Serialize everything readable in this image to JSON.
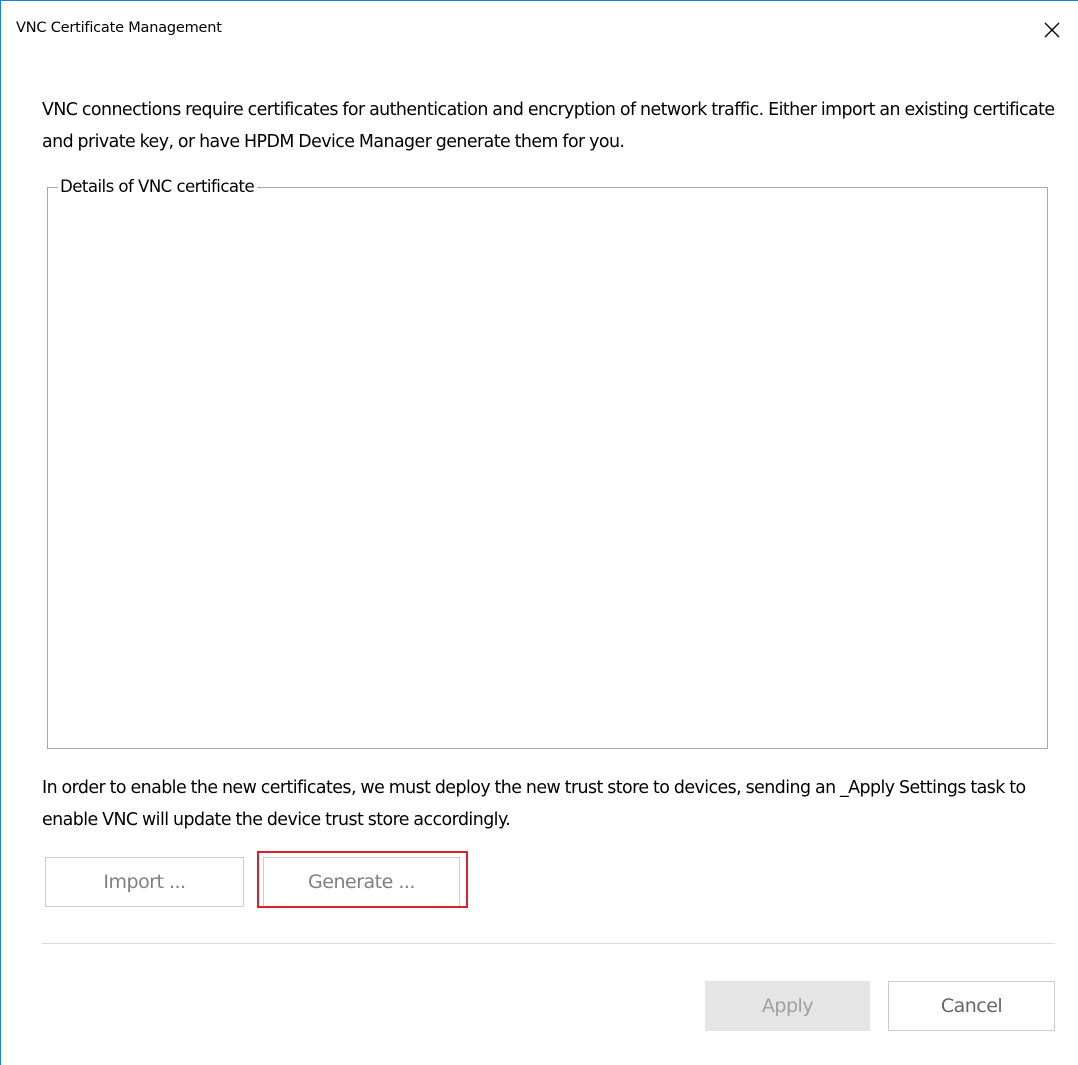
{
  "window": {
    "title": "VNC Certificate Management",
    "accent_color": "#1883d7"
  },
  "intro_text": "VNC connections require certificates for authentication and encryption of network traffic.  Either import an existing certificate and private key, or have HPDM Device Manager generate them for you.",
  "details_group": {
    "legend": "Details of VNC certificate",
    "content": ""
  },
  "note_text": "In order to enable the new certificates, we must deploy the new trust store to devices, sending an _Apply Settings task to enable VNC will update the device trust store accordingly.",
  "buttons": {
    "import_label": "Import ...",
    "generate_label": "Generate ...",
    "apply_label": "Apply",
    "cancel_label": "Cancel"
  },
  "icons": {
    "close": "close-icon"
  },
  "highlight_color": "#d9202b"
}
